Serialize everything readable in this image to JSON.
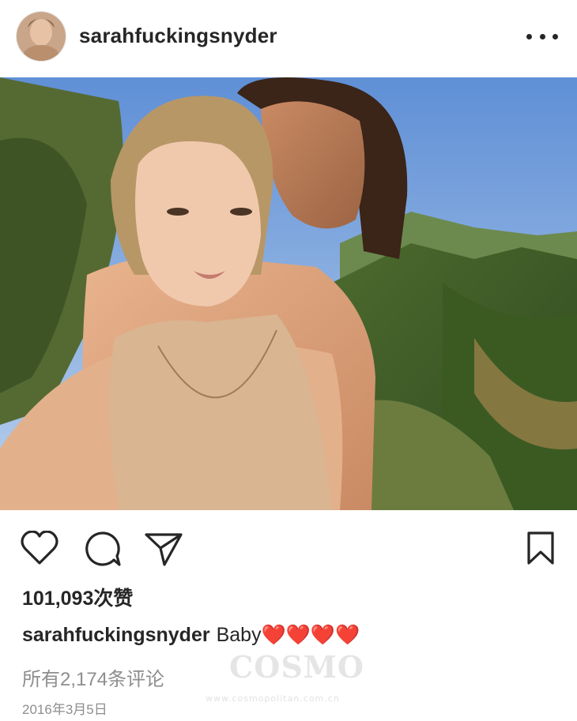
{
  "post": {
    "username": "sarahfuckingsnyder",
    "likes_text": "101,093次赞",
    "caption_user": "sarahfuckingsnyder",
    "caption_text": "Baby❤️❤️❤️❤️",
    "comments_text": "所有2,174条评论",
    "date_text": "2016年3月5日"
  },
  "icons": {
    "more": "more-dots-icon",
    "like": "heart-icon",
    "comment": "comment-bubble-icon",
    "share": "paper-plane-icon",
    "save": "bookmark-icon"
  },
  "watermark": {
    "main": "COSMO",
    "sub": "www.cosmopolitan.com.cn"
  },
  "colors": {
    "text": "#262626",
    "muted": "#8e8e8e",
    "heart": "#e0312e"
  }
}
